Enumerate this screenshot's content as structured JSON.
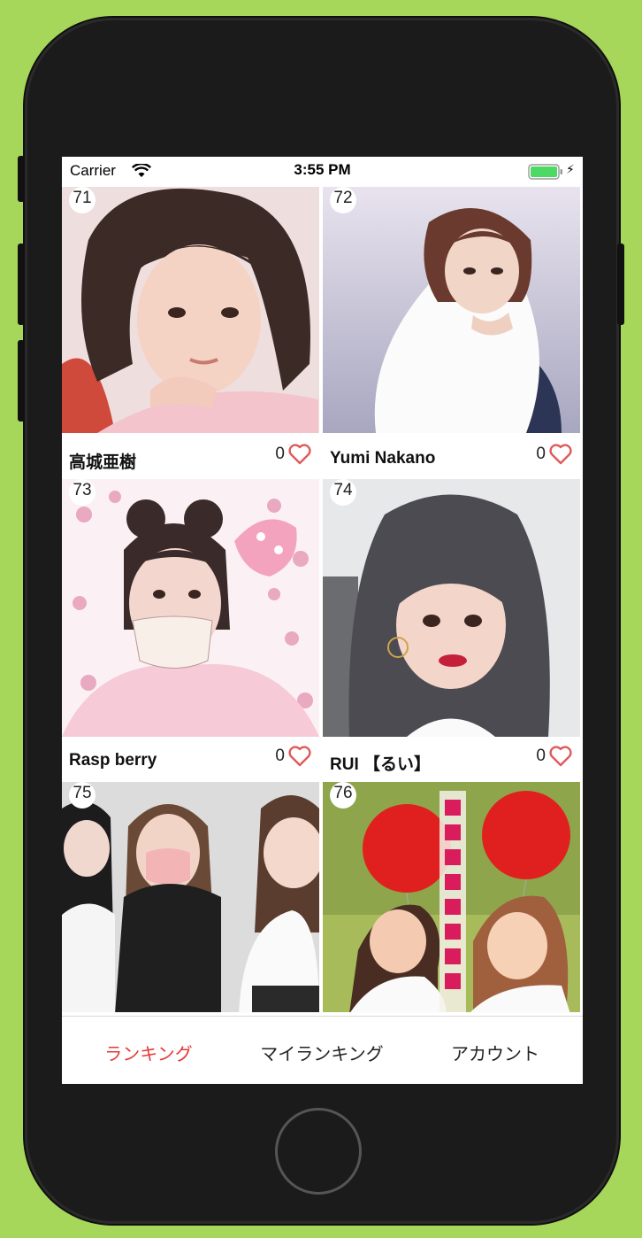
{
  "status_bar": {
    "carrier": "Carrier",
    "time": "3:55 PM"
  },
  "cards": [
    {
      "rank": "71",
      "name": "高城亜樹",
      "likes": "0",
      "bg": "#e9c9c9"
    },
    {
      "rank": "72",
      "name": "Yumi Nakano",
      "likes": "0",
      "bg": "#c9c8d8"
    },
    {
      "rank": "73",
      "name": "Rasp berry",
      "likes": "0",
      "bg": "#f4dbe3"
    },
    {
      "rank": "74",
      "name": "RUI 【るい】",
      "likes": "0",
      "bg": "#8c8a8f"
    },
    {
      "rank": "75",
      "name": "",
      "likes": "",
      "bg": "#d8d8d8"
    },
    {
      "rank": "76",
      "name": "",
      "likes": "",
      "bg": "#8aa847"
    }
  ],
  "tabs": [
    {
      "label": "ランキング",
      "active": true
    },
    {
      "label": "マイランキング",
      "active": false
    },
    {
      "label": "アカウント",
      "active": false
    }
  ],
  "colors": {
    "accent": "#e53935",
    "heart": "#e05a5a",
    "device_bg": "#a6d65a"
  }
}
